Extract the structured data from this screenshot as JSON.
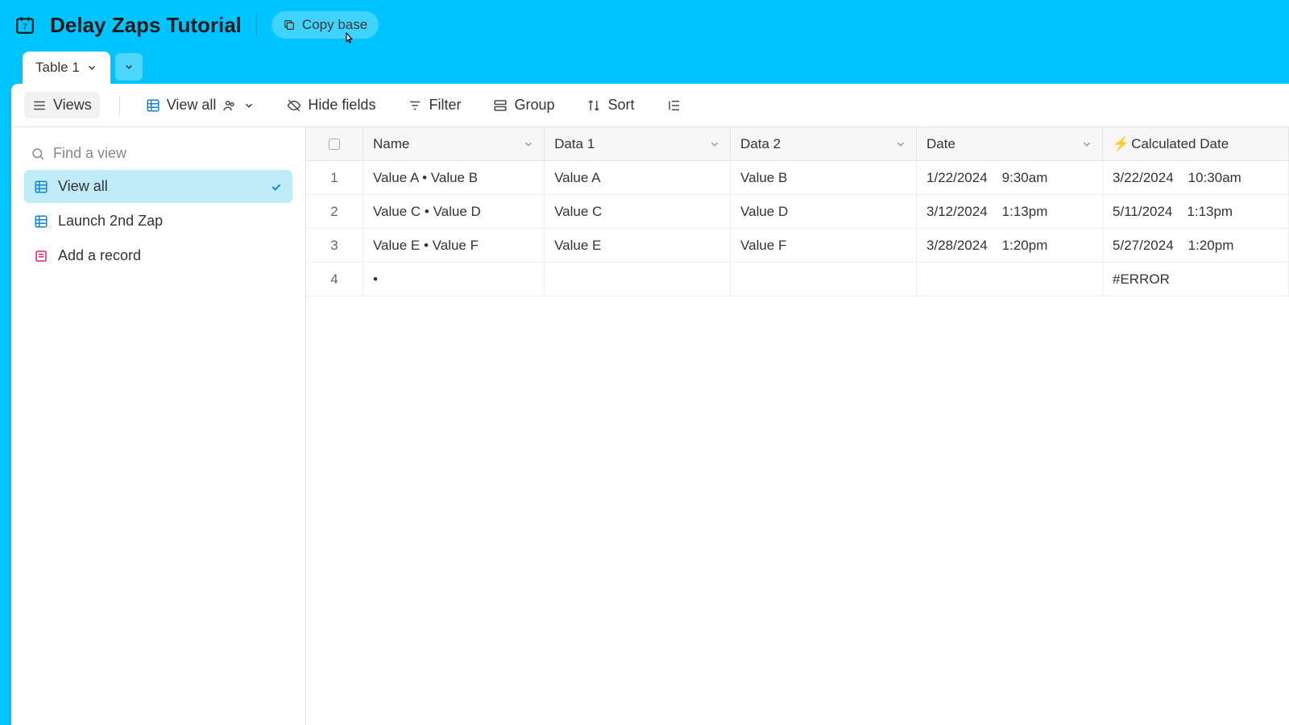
{
  "header": {
    "title": "Delay Zaps Tutorial",
    "copy_base": "Copy base"
  },
  "tabs": {
    "active": "Table 1"
  },
  "toolbar": {
    "views": "Views",
    "view_all": "View all",
    "hide_fields": "Hide fields",
    "filter": "Filter",
    "group": "Group",
    "sort": "Sort"
  },
  "sidebar": {
    "find_placeholder": "Find a view",
    "views": [
      {
        "label": "View all",
        "type": "grid",
        "active": true
      },
      {
        "label": "Launch 2nd Zap",
        "type": "grid",
        "active": false
      },
      {
        "label": "Add a record",
        "type": "form",
        "active": false
      }
    ]
  },
  "columns": {
    "name": "Name",
    "data1": "Data 1",
    "data2": "Data 2",
    "date": "Date",
    "calc": "Calculated Date",
    "calc_icon": "⚡"
  },
  "rows": [
    {
      "num": "1",
      "name": "Value A • Value B",
      "data1": "Value A",
      "data2": "Value B",
      "date": "1/22/2024",
      "time": "9:30am",
      "calc_date": "3/22/2024",
      "calc_time": "10:30am"
    },
    {
      "num": "2",
      "name": "Value C • Value D",
      "data1": "Value C",
      "data2": "Value D",
      "date": "3/12/2024",
      "time": "1:13pm",
      "calc_date": "5/11/2024",
      "calc_time": "1:13pm"
    },
    {
      "num": "3",
      "name": "Value E • Value F",
      "data1": "Value E",
      "data2": "Value F",
      "date": "3/28/2024",
      "time": "1:20pm",
      "calc_date": "5/27/2024",
      "calc_time": "1:20pm"
    },
    {
      "num": "4",
      "name": "•",
      "data1": "",
      "data2": "",
      "date": "",
      "time": "",
      "calc_date": "#ERROR",
      "calc_time": ""
    }
  ]
}
